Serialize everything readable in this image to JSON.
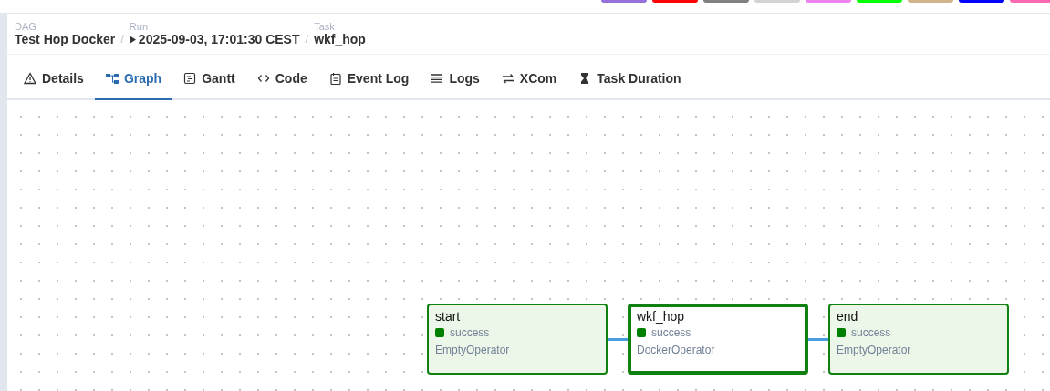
{
  "legend": [
    {
      "color": "#9370db"
    },
    {
      "color": "#ff0000"
    },
    {
      "color": "#808080"
    },
    {
      "color": "#d3d3d3"
    },
    {
      "color": "#ee82ee"
    },
    {
      "color": "#00ff00"
    },
    {
      "color": "#d2b48c"
    },
    {
      "color": "#0000ff"
    },
    {
      "color": "#ff69b4"
    }
  ],
  "breadcrumbs": [
    {
      "kind": "text",
      "label": "DAG",
      "value": "Test Hop Docker"
    },
    {
      "kind": "run",
      "label": "Run",
      "value": "2025-09-03, 17:01:30 CEST",
      "separator": "/"
    },
    {
      "kind": "text",
      "label": "Task",
      "value": "wkf_hop",
      "separator": "/"
    }
  ],
  "tabs": [
    {
      "kind": "details",
      "label": "Details",
      "selected": false
    },
    {
      "kind": "graph",
      "label": "Graph",
      "selected": true
    },
    {
      "kind": "gantt",
      "label": "Gantt",
      "selected": false
    },
    {
      "kind": "code",
      "label": "Code",
      "selected": false
    },
    {
      "kind": "event",
      "label": "Event Log",
      "selected": false
    },
    {
      "kind": "logs",
      "label": "Logs",
      "selected": false
    },
    {
      "kind": "xcom",
      "label": "XCom",
      "selected": false
    },
    {
      "kind": "duration",
      "label": "Task Duration",
      "selected": false
    }
  ],
  "graph": {
    "nodes": [
      {
        "name": "start",
        "state": "success",
        "color": "#008000",
        "operator": "EmptyOperator",
        "selected": false
      },
      {
        "name": "wkf_hop",
        "state": "success",
        "color": "#008000",
        "operator": "DockerOperator",
        "selected": true
      },
      {
        "name": "end",
        "state": "success",
        "color": "#008000",
        "operator": "EmptyOperator",
        "selected": false
      }
    ]
  }
}
